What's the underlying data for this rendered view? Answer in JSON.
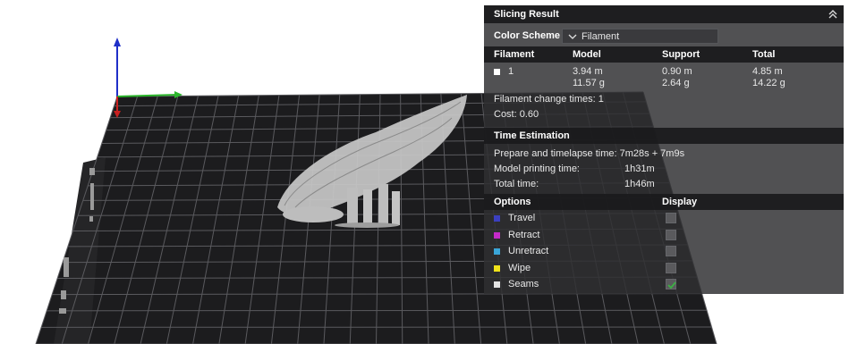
{
  "panel": {
    "title": "Slicing Result",
    "color_scheme_label": "Color Scheme",
    "color_scheme_value": "Filament",
    "filament_table": {
      "headers": [
        "Filament",
        "Model",
        "Support",
        "Total"
      ],
      "rows": [
        {
          "filament": "1",
          "model_length": "3.94 m",
          "model_weight": "11.57 g",
          "support_length": "0.90 m",
          "support_weight": "2.64 g",
          "total_length": "4.85 m",
          "total_weight": "14.22 g"
        }
      ]
    },
    "filament_change": "Filament change times:  1",
    "cost": "Cost:  0.60",
    "time_estimation": {
      "title": "Time Estimation",
      "prepare": "Prepare and timelapse time: 7m28s + 7m9s",
      "model_label": "Model printing time:",
      "model_value": "1h31m",
      "total_label": "Total time:",
      "total_value": "1h46m"
    },
    "options": {
      "header": "Options",
      "display_header": "Display",
      "items": [
        {
          "label": "Travel",
          "color": "#3b3fbf",
          "checked": false
        },
        {
          "label": "Retract",
          "color": "#c42ac8",
          "checked": false
        },
        {
          "label": "Unretract",
          "color": "#3aa6d9",
          "checked": false
        },
        {
          "label": "Wipe",
          "color": "#f0e21a",
          "checked": false
        },
        {
          "label": "Seams",
          "color": "#e4e4e4",
          "checked": true
        }
      ]
    },
    "check_color": "#3cb043"
  },
  "viewport": {
    "bed_color": "#1c1c1e",
    "grid_color": "#5a5a5e",
    "model_color": "#c8c8c8",
    "axis_colors": {
      "x": "#2bb52b",
      "y": "#1f2fc8",
      "z": "#c82020"
    }
  }
}
